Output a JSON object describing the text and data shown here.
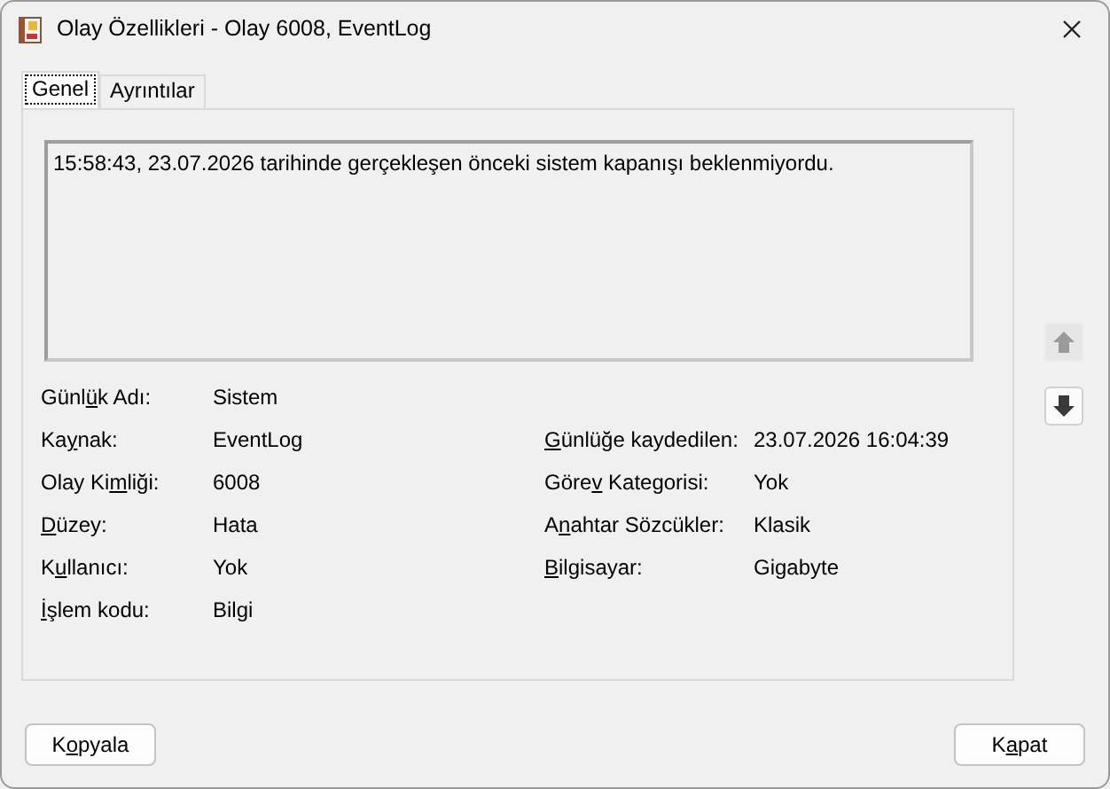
{
  "window": {
    "title": "Olay Özellikleri - Olay 6008, EventLog"
  },
  "tabs": [
    {
      "label": "Genel",
      "selected": true
    },
    {
      "label": "Ayrıntılar",
      "selected": false
    }
  ],
  "description": "15:58:43, 23.07.2026 tarihinde gerçekleşen önceki sistem kapanışı beklenmiyordu.",
  "rows": [
    {
      "left": {
        "label_parts": {
          "pre": "Günl",
          "key": "ü",
          "post": "k Adı:"
        },
        "value": "Sistem"
      }
    },
    {
      "left": {
        "label_parts": {
          "pre": "Ka",
          "key": "y",
          "post": "nak:"
        },
        "value": "EventLog"
      },
      "right": {
        "label_parts": {
          "key": "G",
          "post": "ünlüğe kaydedilen:"
        },
        "value": "23.07.2026 16:04:39"
      }
    },
    {
      "left": {
        "label_parts": {
          "pre": "Olay Ki",
          "key": "m",
          "post": "liği:"
        },
        "value": "6008"
      },
      "right": {
        "label_parts": {
          "pre": "Göre",
          "key": "v",
          "post": " Kategorisi:"
        },
        "value": "Yok"
      }
    },
    {
      "left": {
        "label_parts": {
          "key": "D",
          "post": "üzey:"
        },
        "value": "Hata"
      },
      "right": {
        "label_parts": {
          "pre": "A",
          "key": "n",
          "post": "ahtar Sözcükler:"
        },
        "value": "Klasik"
      }
    },
    {
      "left": {
        "label_parts": {
          "pre": "K",
          "key": "u",
          "post": "llanıcı:"
        },
        "value": "Yok"
      },
      "right": {
        "label_parts": {
          "key": "B",
          "post": "ilgisayar:"
        },
        "value": "Gigabyte"
      }
    },
    {
      "left": {
        "label_parts": {
          "key": "İ",
          "post": "şlem kodu:"
        },
        "value": "Bilgi"
      }
    }
  ],
  "nav_buttons": [
    {
      "kind": "up",
      "disabled": true
    },
    {
      "kind": "down",
      "disabled": false
    }
  ],
  "buttons": [
    {
      "label_parts": {
        "pre": "K",
        "key": "o",
        "post": "pyala"
      }
    },
    {
      "label_parts": {
        "pre": "K",
        "key": "a",
        "post": "pat"
      }
    }
  ]
}
